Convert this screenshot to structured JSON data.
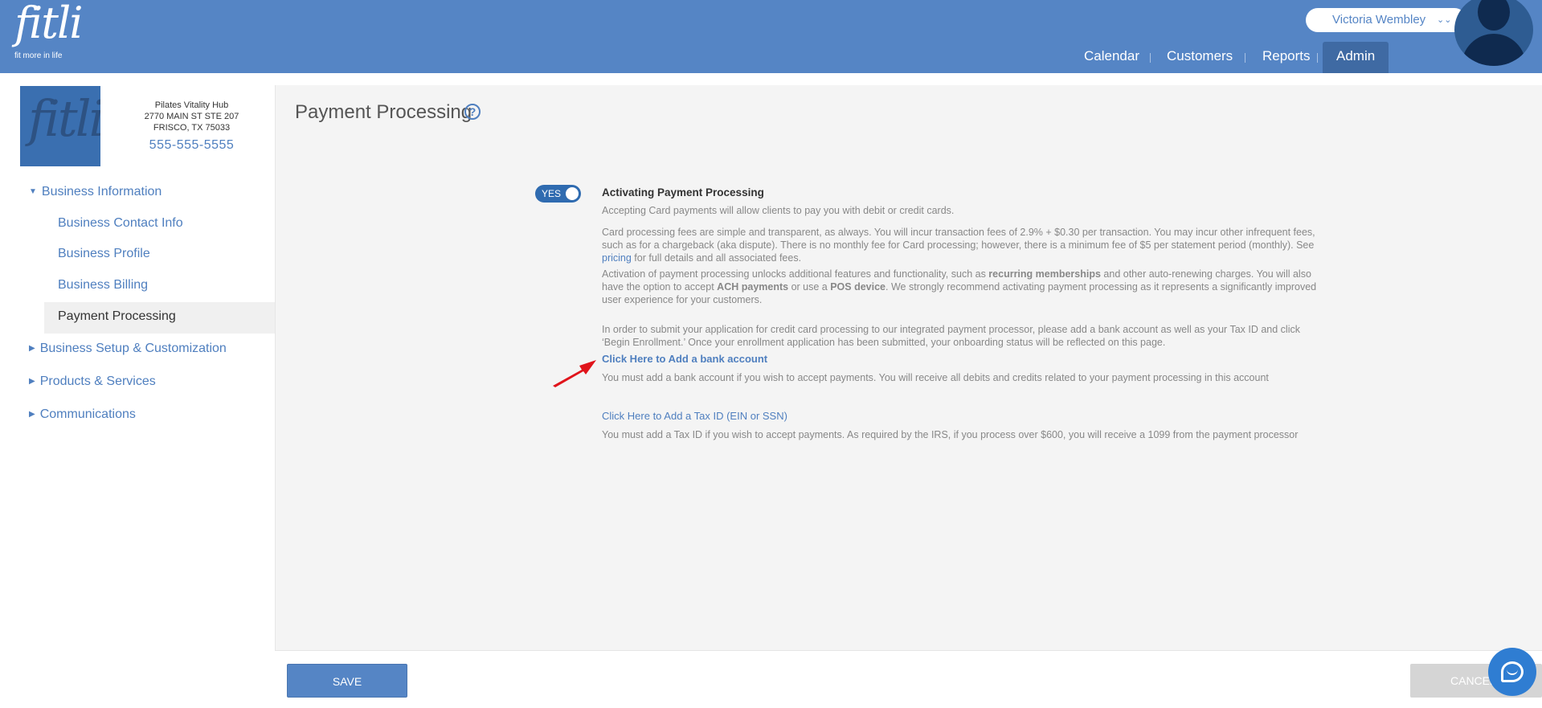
{
  "brand": {
    "logo_word": "fitli",
    "logo_tagline": "fit more in life"
  },
  "header": {
    "user_name": "Victoria Wembley",
    "nav": [
      "Calendar",
      "Customers",
      "Reports",
      "Admin"
    ],
    "active_nav": "Admin"
  },
  "business": {
    "name": "Pilates Vitality Hub",
    "address1": "2770 MAIN ST STE 207",
    "address2": "FRISCO, TX 75033",
    "phone": "555-555-5555"
  },
  "sidebar": {
    "items": [
      {
        "label": "Business Information",
        "expanded": true
      },
      {
        "label": "Business Contact Info"
      },
      {
        "label": "Business Profile"
      },
      {
        "label": "Business Billing"
      },
      {
        "label": "Payment Processing",
        "selected": true
      },
      {
        "label": "Business Setup & Customization"
      },
      {
        "label": "Products & Services"
      },
      {
        "label": "Communications"
      }
    ]
  },
  "main": {
    "title": "Payment Processing",
    "toggle_label": "YES",
    "section_title": "Activating Payment Processing",
    "p1": "Accepting Card payments will allow clients to pay you with debit or credit cards.",
    "p2_a": "Card processing fees are simple and transparent, as always. You will incur transaction fees of 2.9% + $0.30 per transaction. You may incur other infrequent fees, such as for a chargeback (aka dispute). There is no monthly fee for Card processing; however, there is a minimum fee of $5 per statement period (monthly). See ",
    "p2_link": "pricing",
    "p2_b": " for full details and all associated fees.",
    "p3_a": "Activation of payment processing unlocks additional features and functionality, such as ",
    "p3_b1": "recurring memberships",
    "p3_c": " and other auto-renewing charges. You will also have the option to accept ",
    "p3_b2": "ACH payments",
    "p3_d": " or use a ",
    "p3_b3": "POS device",
    "p3_e": ". We strongly recommend activating payment processing as it represents a significantly improved user experience for your customers.",
    "p4": "In order to submit your application for credit card processing to our integrated payment processor, please add a bank account as well as your Tax ID and click ‘Begin Enrollment.’ Once your enrollment application has been submitted, your onboarding status will be reflected on this page.",
    "bank_link": "Click Here to Add a bank account",
    "bank_note": "You must add a bank account if you wish to accept payments. You will receive all debits and credits related to your payment processing in this account",
    "tax_link": "Click Here to Add a Tax ID (EIN or SSN)",
    "tax_note": "You must add a Tax ID if you wish to accept payments. As required by the IRS, if you process over $600, you will receive a 1099 from the payment processor"
  },
  "footer": {
    "save_label": "SAVE",
    "cancel_label": "CANCEL"
  },
  "colors": {
    "brand_blue": "#5585c5",
    "link_blue": "#4f7fbf",
    "nav_active": "#3f6aa3"
  }
}
